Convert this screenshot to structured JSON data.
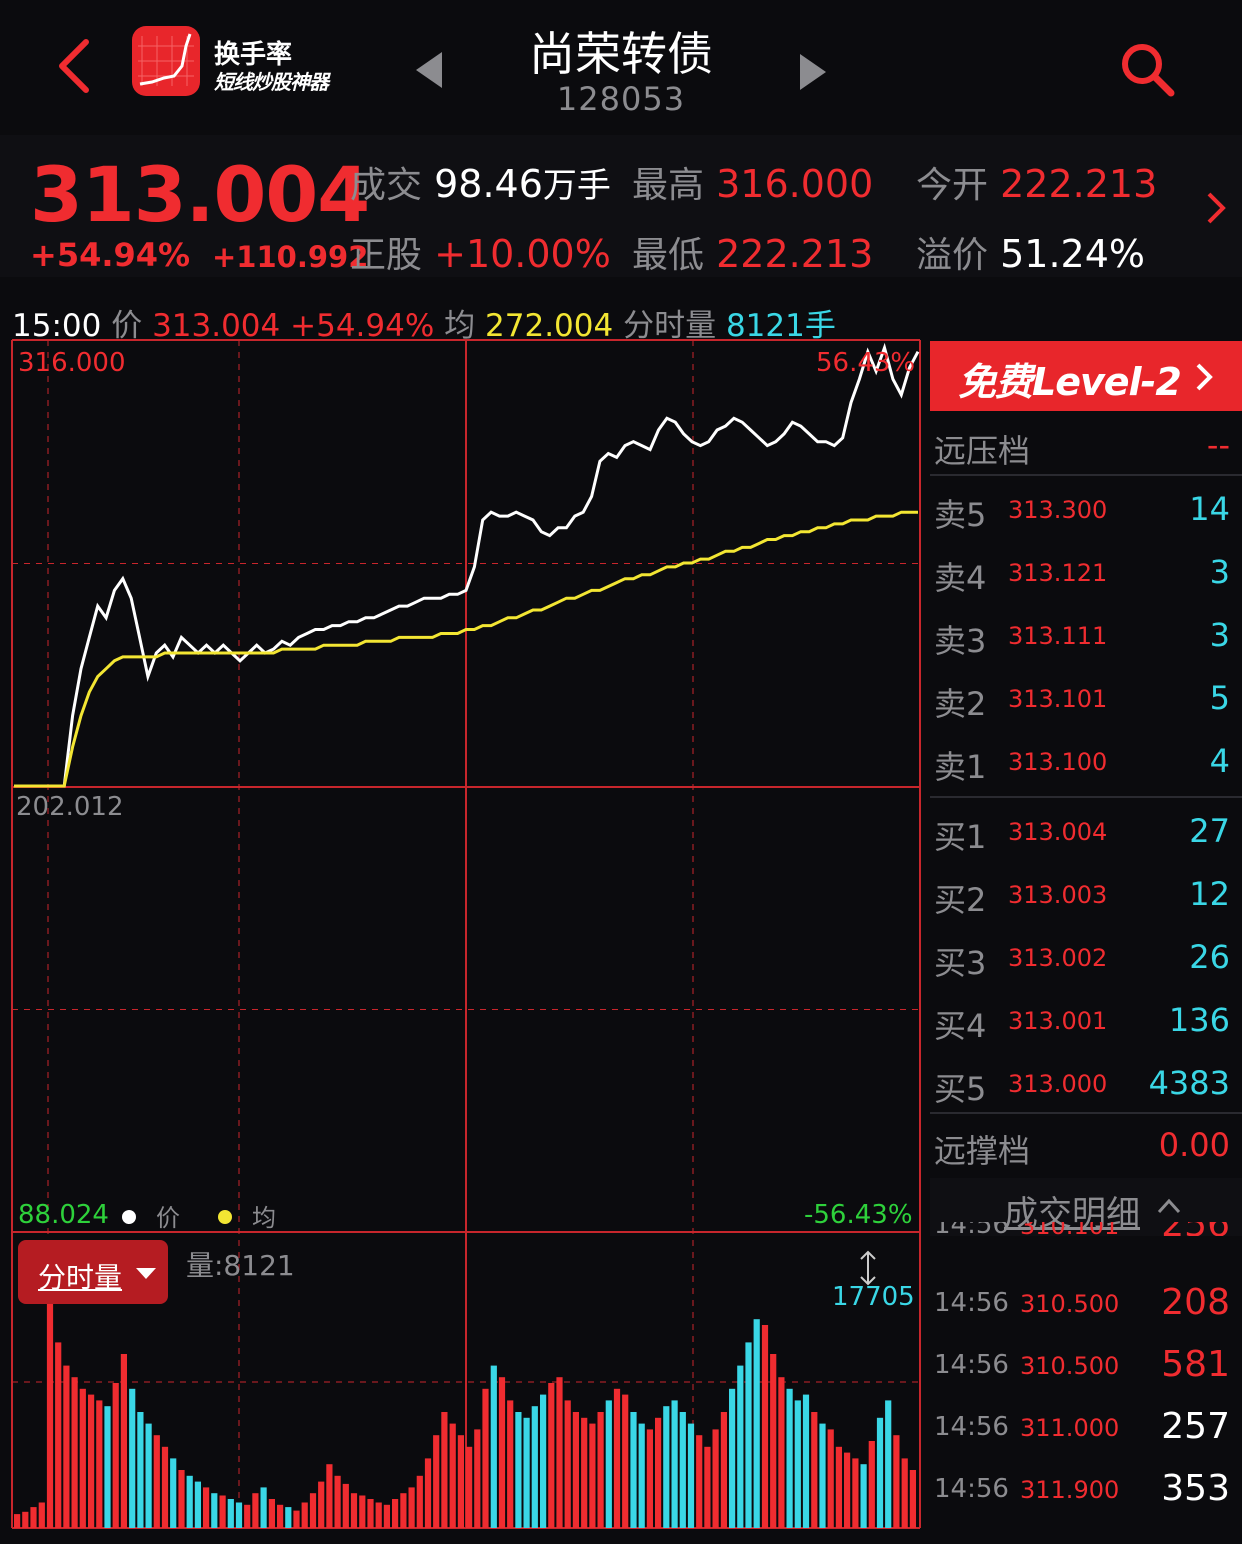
{
  "header": {
    "app_name": "换手率",
    "app_slogan": "短线炒股神器",
    "title": "尚荣转债",
    "code": "128053"
  },
  "quote": {
    "price": "313.004",
    "change_pct": "+54.94%",
    "change_amt": "+110.992",
    "volume_label": "成交",
    "volume_value": "98.46",
    "volume_unit": "万手",
    "high_label": "最高",
    "high_value": "316.000",
    "open_label": "今开",
    "open_value": "222.213",
    "stock_label": "正股",
    "stock_value": "+10.00%",
    "low_label": "最低",
    "low_value": "222.213",
    "premium_label": "溢价",
    "premium_value": "51.24%"
  },
  "info": {
    "time": "15:00",
    "price_label": "价",
    "price": "313.004",
    "pct": "+54.94%",
    "avg_label": "均",
    "avg": "272.004",
    "vol_label": "分时量",
    "vol": "8121手"
  },
  "chart_labels": {
    "top_left": "316.000",
    "top_right": "56.43%",
    "mid_left": "202.012",
    "bottom_left": "88.024",
    "bottom_right": "-56.43%",
    "legend_price": "价",
    "legend_avg": "均",
    "vol_button": "分时量",
    "vol_text": "量:8121",
    "vol_max": "17705"
  },
  "chart_data": {
    "type": "line",
    "title": "",
    "ylim": [
      88.024,
      316.0
    ],
    "y_ticks": [
      "316.000",
      "202.012",
      "88.024"
    ],
    "pct_ticks": [
      "56.43%",
      "-56.43%"
    ],
    "series": [
      {
        "name": "价",
        "color": "#ffffff",
        "values": [
          202.0,
          202.0,
          202.0,
          202.0,
          202.0,
          202.0,
          202.0,
          220,
          232,
          240,
          248,
          245,
          252,
          255,
          250,
          240,
          230,
          236,
          238,
          235,
          240,
          238,
          236,
          238,
          236,
          238,
          236,
          234,
          236,
          238,
          236,
          237,
          239,
          238,
          240,
          241,
          242,
          242,
          243,
          243,
          244,
          244,
          245,
          245,
          246,
          247,
          248,
          248,
          249,
          250,
          250,
          250,
          251,
          251,
          252,
          258,
          270,
          272,
          271,
          271,
          272,
          271,
          270,
          267,
          266,
          268,
          268,
          271,
          272,
          276,
          285,
          287,
          286,
          289,
          290,
          289,
          288,
          293,
          296,
          295,
          292,
          290,
          289,
          290,
          293,
          294,
          296,
          295,
          293,
          291,
          289,
          290,
          292,
          295,
          294,
          292,
          290,
          290,
          289,
          291,
          300,
          306,
          313,
          308,
          314,
          306,
          302,
          309,
          313
        ]
      },
      {
        "name": "均",
        "color": "#f3e633",
        "values": [
          202.0,
          202.0,
          202.0,
          202.0,
          202.0,
          202.0,
          202.0,
          212,
          220,
          226,
          230,
          232,
          234,
          235,
          235,
          235,
          235,
          235,
          236,
          236,
          236,
          236,
          236,
          236,
          236,
          236,
          236,
          236,
          236,
          236,
          236,
          236,
          237,
          237,
          237,
          237,
          237,
          238,
          238,
          238,
          238,
          238,
          239,
          239,
          239,
          239,
          240,
          240,
          240,
          240,
          240,
          241,
          241,
          241,
          242,
          242,
          243,
          243,
          244,
          245,
          245,
          246,
          247,
          247,
          248,
          249,
          250,
          250,
          251,
          252,
          252,
          253,
          254,
          255,
          255,
          256,
          256,
          257,
          258,
          258,
          259,
          259,
          260,
          260,
          261,
          262,
          262,
          263,
          263,
          264,
          265,
          265,
          266,
          266,
          267,
          267,
          268,
          268,
          269,
          269,
          270,
          270,
          270,
          271,
          271,
          271,
          272,
          272,
          272
        ]
      },
      {
        "name": "量",
        "color": "#f02c30",
        "values": [
          12,
          14,
          18,
          22,
          200,
          160,
          140,
          130,
          120,
          115,
          110,
          105,
          125,
          150,
          120,
          100,
          90,
          80,
          70,
          60,
          50,
          45,
          40,
          35,
          30,
          28,
          25,
          22,
          20,
          30,
          35,
          25,
          20,
          18,
          15,
          22,
          30,
          40,
          55,
          45,
          38,
          30,
          28,
          25,
          22,
          20,
          25,
          30,
          35,
          45,
          60,
          80,
          100,
          90,
          80,
          70,
          85,
          120,
          140,
          130,
          110,
          100,
          95,
          105,
          115,
          125,
          130,
          110,
          100,
          95,
          90,
          100,
          110,
          120,
          115,
          100,
          90,
          85,
          95,
          105,
          110,
          100,
          90,
          80,
          70,
          85,
          100,
          120,
          140,
          160,
          180,
          175,
          150,
          130,
          120,
          110,
          115,
          100,
          90,
          85,
          70,
          65,
          60,
          55,
          75,
          95,
          110,
          80,
          60,
          50
        ]
      }
    ]
  },
  "orderbook": {
    "level2_label": "免费Level-2",
    "far_pressure_label": "远压档",
    "far_pressure_value": "--",
    "asks": [
      {
        "label": "卖5",
        "price": "313.300",
        "vol": "14"
      },
      {
        "label": "卖4",
        "price": "313.121",
        "vol": "3"
      },
      {
        "label": "卖3",
        "price": "313.111",
        "vol": "3"
      },
      {
        "label": "卖2",
        "price": "313.101",
        "vol": "5"
      },
      {
        "label": "卖1",
        "price": "313.100",
        "vol": "4"
      }
    ],
    "bids": [
      {
        "label": "买1",
        "price": "313.004",
        "vol": "27"
      },
      {
        "label": "买2",
        "price": "313.003",
        "vol": "12"
      },
      {
        "label": "买3",
        "price": "313.002",
        "vol": "26"
      },
      {
        "label": "买4",
        "price": "313.001",
        "vol": "136"
      },
      {
        "label": "买5",
        "price": "313.000",
        "vol": "4383"
      }
    ],
    "far_support_label": "远撑档",
    "far_support_value": "0.00",
    "trades_title": "成交明细",
    "trades": [
      {
        "time": "14:56",
        "price": "310.101",
        "vol": "256"
      },
      {
        "time": "14:56",
        "price": "310.500",
        "vol": "208"
      },
      {
        "time": "14:56",
        "price": "310.500",
        "vol": "581"
      },
      {
        "time": "14:56",
        "price": "311.000",
        "vol": "257"
      },
      {
        "time": "14:56",
        "price": "311.900",
        "vol": "353"
      }
    ]
  },
  "colors": {
    "up": "#f02c30",
    "cyan": "#3ad7e6",
    "avg": "#f3e633",
    "grid": "#c8262c"
  }
}
